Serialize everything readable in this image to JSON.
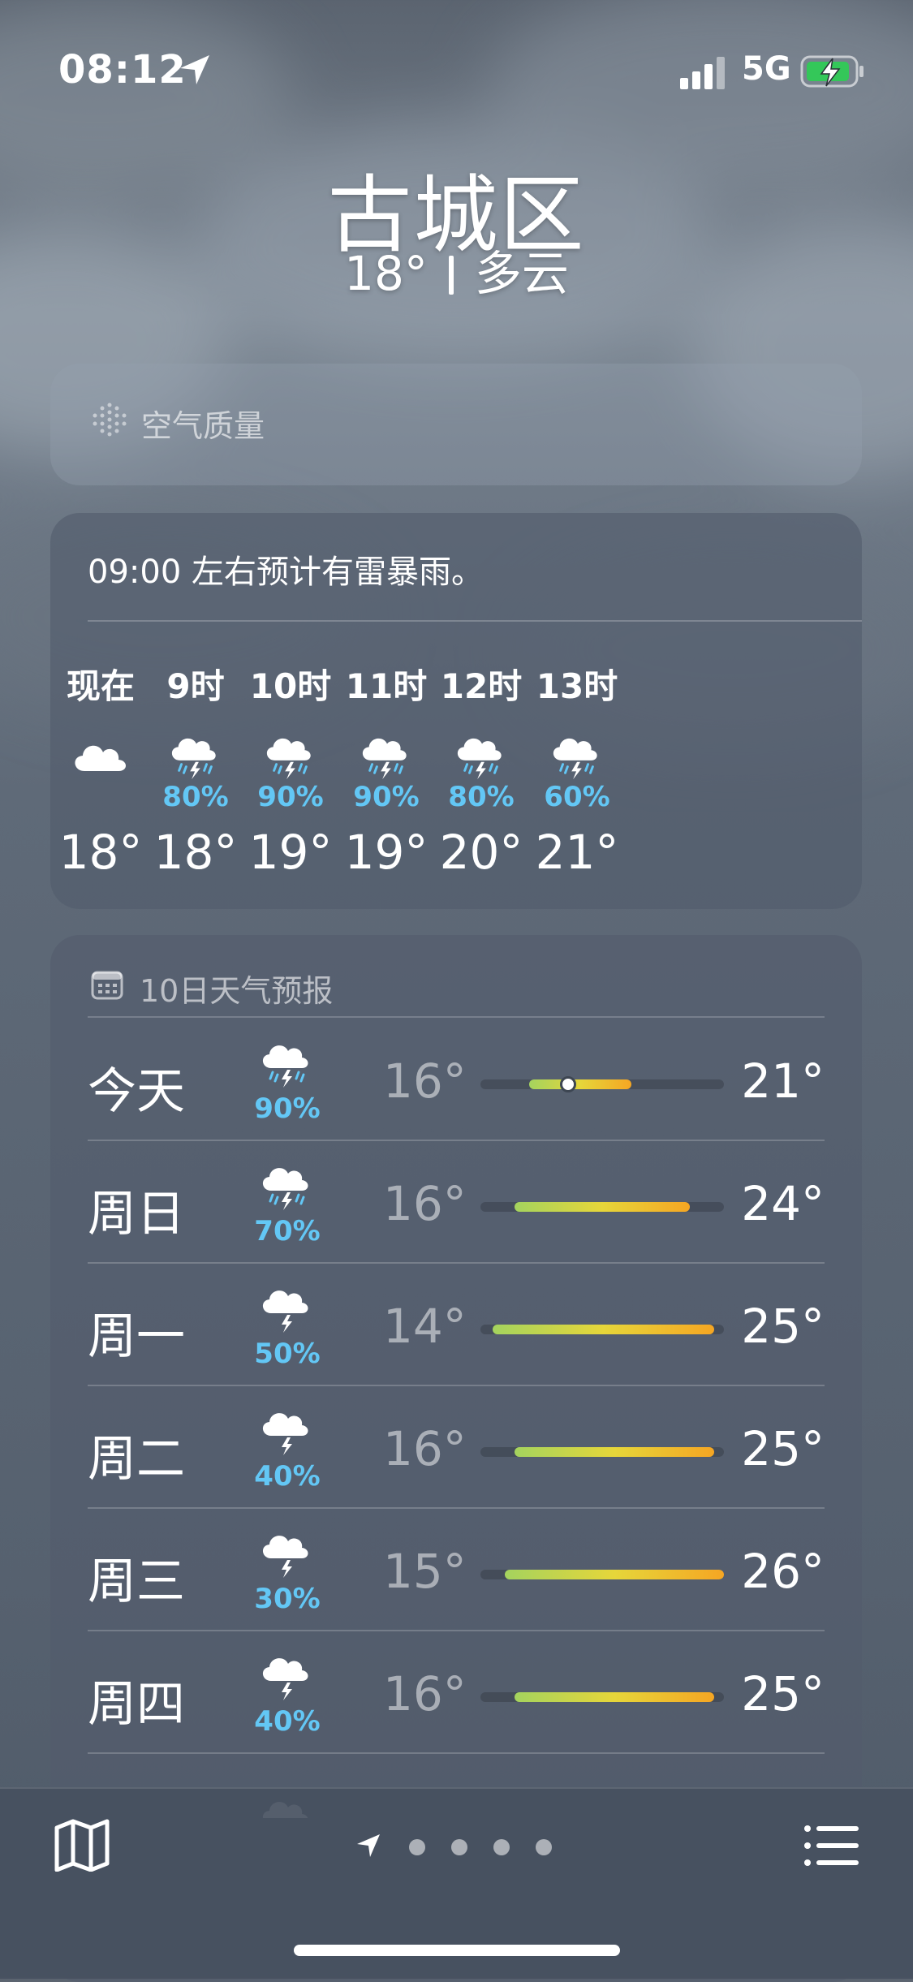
{
  "status": {
    "time": "08:12",
    "network": "5G",
    "battery_color": "#34c759"
  },
  "header": {
    "city": "古城区",
    "temp": "18°",
    "condition": "多云"
  },
  "air_quality": {
    "label": "空气质量",
    "icon": "air-quality-icon"
  },
  "hourly": {
    "summary": "09:00 左右预计有雷暴雨。",
    "hours": [
      {
        "label": "现在",
        "icon": "cloud-icon",
        "pct": "",
        "temp": "18°"
      },
      {
        "label": "9时",
        "icon": "thunderstorm-rain-icon",
        "pct": "80%",
        "temp": "18°"
      },
      {
        "label": "10时",
        "icon": "thunderstorm-rain-icon",
        "pct": "90%",
        "temp": "19°"
      },
      {
        "label": "11时",
        "icon": "thunderstorm-rain-icon",
        "pct": "90%",
        "temp": "19°"
      },
      {
        "label": "12时",
        "icon": "thunderstorm-rain-icon",
        "pct": "80%",
        "temp": "20°"
      },
      {
        "label": "13时",
        "icon": "thunderstorm-rain-icon",
        "pct": "60%",
        "temp": "21°"
      }
    ]
  },
  "daily": {
    "title": "10日天气预报",
    "days": [
      {
        "name": "今天",
        "icon": "thunderstorm-rain-icon",
        "pct": "90%",
        "low": "16°",
        "high": "21°",
        "bar_start": 0.2,
        "bar_end": 0.62,
        "current": 0.36
      },
      {
        "name": "周日",
        "icon": "thunderstorm-rain-icon",
        "pct": "70%",
        "low": "16°",
        "high": "24°",
        "bar_start": 0.14,
        "bar_end": 0.86
      },
      {
        "name": "周一",
        "icon": "thunderstorm-icon",
        "pct": "50%",
        "low": "14°",
        "high": "25°",
        "bar_start": 0.05,
        "bar_end": 0.96
      },
      {
        "name": "周二",
        "icon": "thunderstorm-icon",
        "pct": "40%",
        "low": "16°",
        "high": "25°",
        "bar_start": 0.14,
        "bar_end": 0.96
      },
      {
        "name": "周三",
        "icon": "thunderstorm-icon",
        "pct": "30%",
        "low": "15°",
        "high": "26°",
        "bar_start": 0.1,
        "bar_end": 1.0
      },
      {
        "name": "周四",
        "icon": "thunderstorm-icon",
        "pct": "40%",
        "low": "16°",
        "high": "25°",
        "bar_start": 0.14,
        "bar_end": 0.96
      }
    ]
  },
  "bottom": {
    "map_icon": "map-icon",
    "list_icon": "list-icon",
    "page_count": 4
  }
}
